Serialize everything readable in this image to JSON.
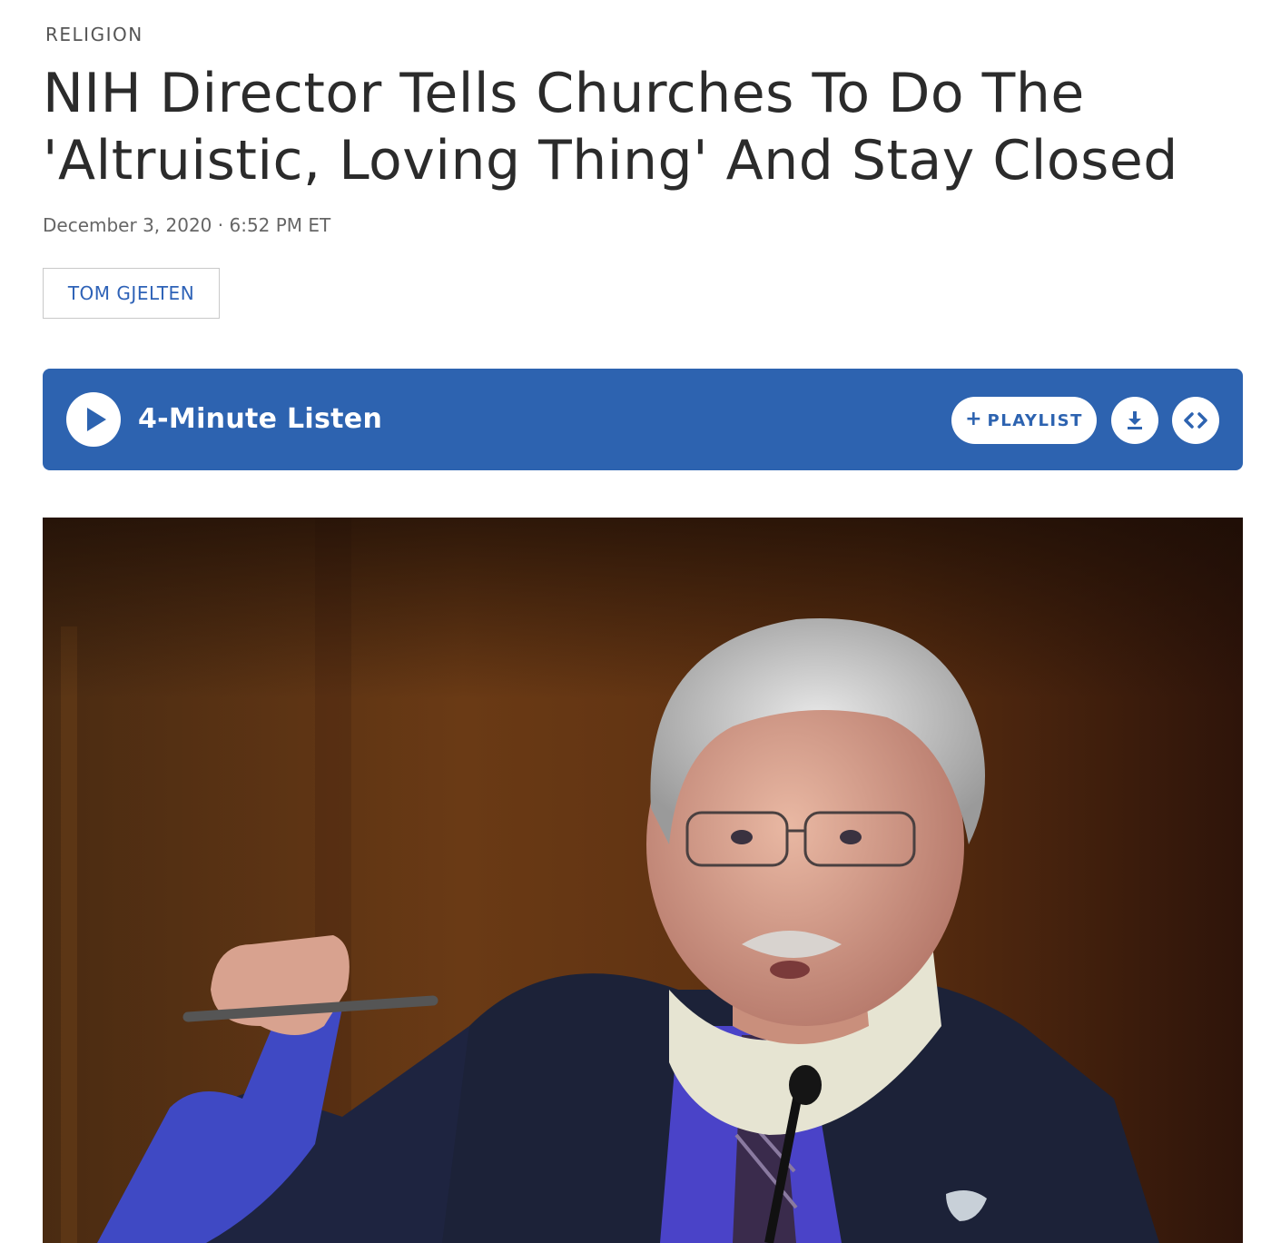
{
  "article": {
    "section": "RELIGION",
    "headline": "NIH Director Tells Churches To Do The 'Altruistic, Loving Thing' And Stay Closed",
    "dateline": "December 3, 2020 · 6:52 PM ET",
    "byline": "TOM GJELTEN"
  },
  "player": {
    "listen_label": "4-Minute Listen",
    "playlist_label": "PLAYLIST",
    "play_icon": "play-icon",
    "playlist_icon": "plus-icon",
    "download_icon": "download-icon",
    "embed_icon": "embed-icon",
    "accent_color": "#2d63b0"
  },
  "colors": {
    "byline_link": "#2e62b7",
    "headline_text": "#2b2b2b",
    "meta_text": "#666666"
  }
}
